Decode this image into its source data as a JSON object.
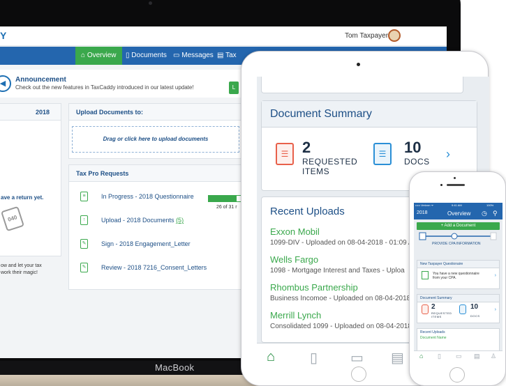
{
  "macbook": {
    "label": "MacBook",
    "topbar": {
      "brand": "Y",
      "user": "Tom Taxpayer ⌄"
    },
    "nav": [
      {
        "icon": "home-icon",
        "label": "Overview",
        "active": true
      },
      {
        "icon": "document-icon",
        "label": "Documents",
        "active": false
      },
      {
        "icon": "chat-icon",
        "label": "Messages",
        "active": false
      },
      {
        "icon": "tax-icon",
        "label": "Tax",
        "active": false
      }
    ],
    "announcement": {
      "title": "Announcement",
      "text": "Check out the new features in TaxCaddy introduced in our latest update!",
      "button_label": "L"
    },
    "left_panel": {
      "year": "2018",
      "line1": "ave a return yet.",
      "form_label": "040",
      "line2": "ow and let your tax",
      "line3": "work their magic!"
    },
    "upload": {
      "header": "Upload Documents to:",
      "drop_text": "Drag or click here to upload documents"
    },
    "requests": {
      "header": "Tax Pro Requests",
      "items": [
        {
          "text": "In Progress - 2018 Questionnaire",
          "link": ""
        },
        {
          "text": "Upload - 2018 Documents ",
          "link": "(5)"
        },
        {
          "text": "Sign - 2018 Engagement_Letter",
          "link": ""
        },
        {
          "text": "Review - 2018 7216_Consent_Letters",
          "link": ""
        }
      ],
      "progress_fraction": 0.84,
      "progress_label": "26 of 31 r"
    }
  },
  "ipad": {
    "summary_title": "Document Summary",
    "requested_count": "2",
    "requested_label_1": "REQUESTED",
    "requested_label_2": "ITEMS",
    "docs_count": "10",
    "docs_label": "DOCS",
    "recent_title": "Recent Uploads",
    "uploads": [
      {
        "name": "Exxon Mobil",
        "desc": "1099-DIV - Uploaded on 08-04-2018 - 01:09 A"
      },
      {
        "name": "Wells Fargo",
        "desc": "1098 - Mortgage Interest and Taxes - Uploa"
      },
      {
        "name": "Rhombus Partnership",
        "desc": "Business Incomoe - Uploaded on 08-04-2018 -"
      },
      {
        "name": "Merrill Lynch",
        "desc": "Consolidated 1099 - Uploaded on 08-04-2018 -"
      }
    ]
  },
  "iphone": {
    "status_carrier": "••••• Verizon ᯤ",
    "status_time": "9:41 AM",
    "status_battery": "100%",
    "year": "2018",
    "title": "Overview",
    "add_button": "+ Add a Document",
    "step_label": "PROVIDE CPA INFORMATION",
    "questionnaire_header": "New Taxpayer Questionaire",
    "questionnaire_line1": "You have a new questionnaire",
    "questionnaire_line2": "from your CPA.",
    "summary_header": "Document Summary",
    "requested_count": "2",
    "requested_label_1": "REQUESTED",
    "requested_label_2": "ITEMS",
    "docs_count": "10",
    "docs_label": "DOCS",
    "recent_header": "Recent Uploads",
    "recent_first": "Document Name"
  }
}
